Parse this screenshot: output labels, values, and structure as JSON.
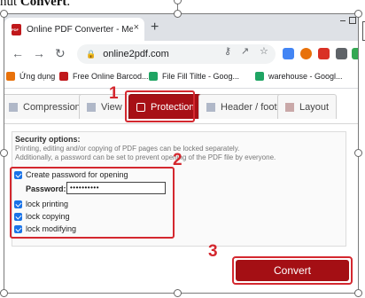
{
  "doc": {
    "prefix": "nút ",
    "bold": "Convert",
    "suffix": "."
  },
  "browser": {
    "tab_title": "Online PDF Converter - Merge, c",
    "tab_close": "×",
    "new_tab": "+",
    "url": "online2pdf.com",
    "bookmarks": [
      {
        "label": "Ứng dụng",
        "icon": "apps-grid-icon",
        "color": "#e8710a"
      },
      {
        "label": "Free Online Barcod...",
        "icon": "barcode-favicon",
        "color": "#c0181b"
      },
      {
        "label": "File Fill Tiltle - Goog...",
        "icon": "google-drive-icon",
        "color": "#1fa463"
      },
      {
        "label": "warehouse - Googl...",
        "icon": "google-drive-icon",
        "color": "#1fa463"
      }
    ]
  },
  "page": {
    "tabs": [
      {
        "label": "Compression",
        "icon": "compression-icon",
        "active": false
      },
      {
        "label": "View",
        "icon": "view-icon",
        "active": false
      },
      {
        "label": "Protection",
        "icon": "lock-icon",
        "active": true
      },
      {
        "label": "Header / footer",
        "icon": "header-footer-icon",
        "active": false
      },
      {
        "label": "Layout",
        "icon": "layout-icon",
        "active": false
      }
    ],
    "security": {
      "title": "Security options:",
      "desc_line1": "Printing, editing and/or copying of PDF pages can be locked separately.",
      "desc_line2": "Additionally, a password can be set to prevent opening of the PDF file by everyone.",
      "create_password": {
        "label": "Create password for opening",
        "checked": true
      },
      "password_label": "Password:",
      "password_value": "••••••••••",
      "lock_printing": {
        "label": "lock printing",
        "checked": true
      },
      "lock_copying": {
        "label": "lock copying",
        "checked": true
      },
      "lock_modifying": {
        "label": "lock modifying",
        "checked": true
      }
    },
    "convert_label": "Convert"
  },
  "steps": [
    "1",
    "2",
    "3"
  ],
  "colors": {
    "accent_red": "#d4282f",
    "brand_red": "#a71016",
    "checkbox_blue": "#1a73e8"
  }
}
